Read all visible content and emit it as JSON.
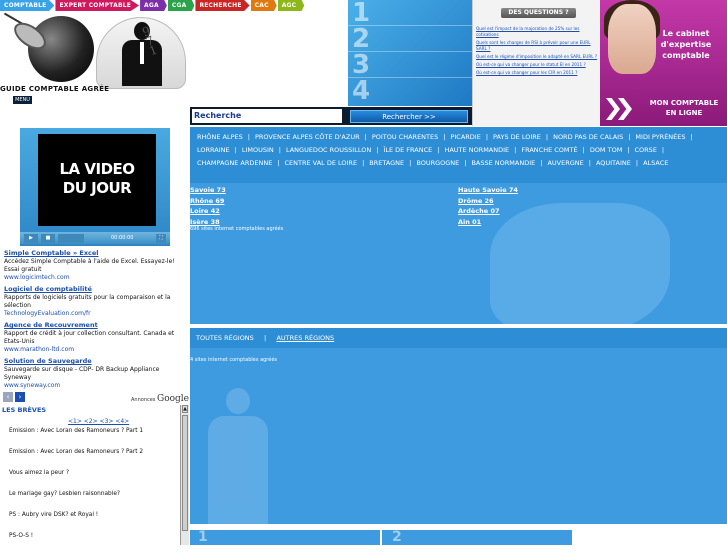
{
  "topnav": [
    "COMPTABLE",
    "EXPERT COMPTABLE",
    "AGA",
    "CGA",
    "RECHERCHE",
    "CAC",
    "AGC"
  ],
  "header": {
    "guide_title": "GUIDE COMPTABLE AGRÉE",
    "menu_label": "MENU",
    "numbers": [
      "1",
      "2",
      "3",
      "4"
    ]
  },
  "questions": {
    "title": "DES QUESTIONS ?",
    "items": [
      "Quel est l'impact de la majoration de 25% sur les cotisations",
      "Quels sont les charges de RSI à prévoir pour une EURL SARL ?",
      "Quel est le régime d'imposition le adapté en SARL EURL ?",
      "Où est-ce qui va changer pour le statut EI en 2011 ?",
      "Où est-ce qui va changer pour les CIR en 2011 ?"
    ]
  },
  "cabinet": {
    "text": [
      "Le cabinet",
      "d'expertise",
      "comptable"
    ],
    "cta": [
      "MON COMPTABLE",
      "EN LIGNE"
    ]
  },
  "search": {
    "label": "Recherche",
    "button": "Rechercher >>"
  },
  "video": {
    "title_line1": "LA VIDEO",
    "title_line2": "DU JOUR",
    "time": "00:00:00"
  },
  "ads": [
    {
      "title": "Simple Comptable » Excel",
      "desc": "Accédez Simple Comptable à l'aide de Excel. Essayez-le! Essai gratuit",
      "url": "www.logicimtech.com"
    },
    {
      "title": "Logiciel de comptabilité",
      "desc": "Rapports de logiciels gratuits pour la comparaison et la sélection",
      "url": "TechnologyEvaluation.com/fr"
    },
    {
      "title": "Agence de Recouvrement",
      "desc": "Rapport de crédit à jour collection consultant. Canada et Etats-Unis",
      "url": "www.marathon-ltd.com"
    },
    {
      "title": "Solution de Sauvegarde",
      "desc": "Sauvegarde sur disque - CDP- DR Backup Appliance Syneway",
      "url": "www.syneway.com"
    }
  ],
  "google": {
    "prefix": "Annonces",
    "brand": "Google"
  },
  "breves": {
    "title": "LES BRÈVES",
    "pages": "<1> <2> <3> <4>",
    "items": [
      "Emission : Avec Loran des Ramoneurs ? Part 1",
      "Emission : Avec Loran des Ramoneurs ? Part 2",
      "Vous aimez la peur ?",
      "Le mariage gay? Lesbien raisonnable?",
      "PS : Aubry vire DSK? et Royal !",
      "PS-O-S !"
    ]
  },
  "regions": [
    "RHÔNE ALPES",
    "PROVENCE ALPES CÔTE D'AZUR",
    "POITOU CHARENTES",
    "PICARDIE",
    "PAYS DE LOIRE",
    "NORD PAS DE CALAIS",
    "MIDI PYRÉNÉES",
    "LORRAINE",
    "LIMOUSIN",
    "LANGUEDOC ROUSSILLON",
    "ÎLE DE FRANCE",
    "HAUTE NORMANDIE",
    "FRANCHE COMTÉ",
    "DOM TOM",
    "CORSE",
    "CHAMPAGNE ARDENNE",
    "CENTRE VAL DE LOIRE",
    "BRETAGNE",
    "BOURGOGNE",
    "BASSE NORMANDIE",
    "AUVERGNE",
    "AQUITAINE",
    "ALSACE"
  ],
  "departments_left": [
    "Savoie 73",
    "Rhône 69",
    "Loire 42",
    "Isère 38"
  ],
  "departments_right": [
    "Haute Savoie 74",
    "Drôme 26",
    "Ardèche 07",
    "Ain 01"
  ],
  "count1": "696 sites internet comptables agréés",
  "regions2": {
    "all": "TOUTES RÉGIONS",
    "sep": "|",
    "other": "AUTRES RÉGIONS"
  },
  "count2": "4 sites internet comptables agréés",
  "bottom_numbers": [
    "1",
    "2"
  ]
}
